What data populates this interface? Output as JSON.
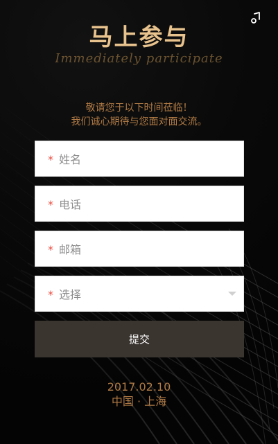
{
  "header": {
    "title": "马上参与",
    "subtitle": "Immediately participate"
  },
  "intro": {
    "line1": "敬请您于以下时间莅临！",
    "line2": "我们诚心期待与您面对面交流。"
  },
  "form": {
    "name": {
      "required_mark": "*",
      "label": "姓名"
    },
    "phone": {
      "required_mark": "*",
      "label": "电话"
    },
    "email": {
      "required_mark": "*",
      "label": "邮箱"
    },
    "choice": {
      "required_mark": "*",
      "label": "选择"
    },
    "submit_label": "提交"
  },
  "footer": {
    "date": "2017.02.10",
    "location": "中国 · 上海"
  },
  "icons": {
    "music": "music-note-icon",
    "dropdown": "chevron-down-icon"
  },
  "colors": {
    "accent_gold": "#e9c38d",
    "accent_brown": "#b07a45",
    "required_red": "#e94a3f",
    "button_bg": "#3b3530"
  }
}
